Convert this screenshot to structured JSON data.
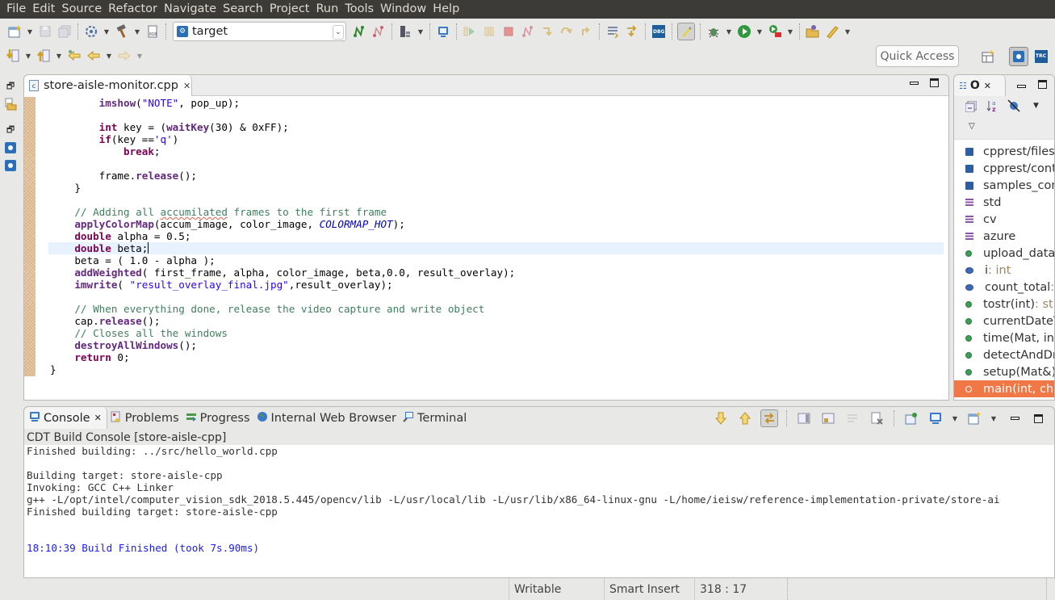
{
  "menubar": {
    "items": [
      "File",
      "Edit",
      "Source",
      "Refactor",
      "Navigate",
      "Search",
      "Project",
      "Run",
      "Tools",
      "Window",
      "Help"
    ]
  },
  "toolbar": {
    "target_combo": {
      "value": "target",
      "icon": "launch-config-icon"
    },
    "quick_access_label": "Quick Access"
  },
  "editor": {
    "tab_label": "store-aisle-monitor.cpp",
    "code_lines": [
      {
        "indent": "        ",
        "tokens": [
          [
            "fn",
            "imshow"
          ],
          [
            "",
            "("
          ],
          [
            "str",
            "\"NOTE\""
          ],
          [
            "",
            ", pop_up);"
          ]
        ]
      },
      {
        "indent": "",
        "tokens": []
      },
      {
        "indent": "        ",
        "tokens": [
          [
            "kw",
            "int"
          ],
          [
            "",
            " key = ("
          ],
          [
            "fn",
            "waitKey"
          ],
          [
            "",
            "(30) & 0xFF);"
          ]
        ]
      },
      {
        "indent": "        ",
        "tokens": [
          [
            "kw",
            "if"
          ],
          [
            "",
            "(key =="
          ],
          [
            "chr",
            "'q'"
          ],
          [
            "",
            ")"
          ]
        ]
      },
      {
        "indent": "            ",
        "tokens": [
          [
            "kw",
            "break"
          ],
          [
            "",
            ";"
          ]
        ]
      },
      {
        "indent": "",
        "tokens": []
      },
      {
        "indent": "        ",
        "tokens": [
          [
            "",
            "frame."
          ],
          [
            "fn",
            "release"
          ],
          [
            "",
            "();"
          ]
        ]
      },
      {
        "indent": "    ",
        "tokens": [
          [
            "",
            "}"
          ]
        ]
      },
      {
        "indent": "",
        "tokens": []
      },
      {
        "indent": "    ",
        "tokens": [
          [
            "cm",
            "// Adding all "
          ],
          [
            "cm squig",
            "accumilated"
          ],
          [
            "cm",
            " frames to the first frame"
          ]
        ]
      },
      {
        "indent": "    ",
        "tokens": [
          [
            "fn",
            "applyColorMap"
          ],
          [
            "",
            "(accum_image, color_image, "
          ],
          [
            "it",
            "COLORMAP_HOT"
          ],
          [
            "",
            ");"
          ]
        ]
      },
      {
        "indent": "    ",
        "tokens": [
          [
            "kw",
            "double"
          ],
          [
            "",
            " alpha = 0.5;"
          ]
        ]
      },
      {
        "indent": "    ",
        "tokens": [
          [
            "kw",
            "double"
          ],
          [
            "",
            " beta;"
          ],
          [
            "caret",
            ""
          ]
        ],
        "current": true
      },
      {
        "indent": "    ",
        "tokens": [
          [
            "",
            "beta = ( 1.0 - alpha );"
          ]
        ]
      },
      {
        "indent": "    ",
        "tokens": [
          [
            "fn",
            "addWeighted"
          ],
          [
            "",
            "( first_frame, alpha, color_image, beta,0.0, result_overlay);"
          ]
        ]
      },
      {
        "indent": "    ",
        "tokens": [
          [
            "fn",
            "imwrite"
          ],
          [
            "",
            "( "
          ],
          [
            "str",
            "\"result_overlay_final.jpg\""
          ],
          [
            "",
            ",result_overlay);"
          ]
        ]
      },
      {
        "indent": "",
        "tokens": []
      },
      {
        "indent": "    ",
        "tokens": [
          [
            "cm",
            "// When everything done, release the video capture and write object"
          ]
        ]
      },
      {
        "indent": "    ",
        "tokens": [
          [
            "",
            "cap."
          ],
          [
            "fn",
            "release"
          ],
          [
            "",
            "();"
          ]
        ]
      },
      {
        "indent": "    ",
        "tokens": [
          [
            "cm",
            "// Closes all the windows"
          ]
        ]
      },
      {
        "indent": "    ",
        "tokens": [
          [
            "fn",
            "destroyAllWindows"
          ],
          [
            "",
            "();"
          ]
        ]
      },
      {
        "indent": "    ",
        "tokens": [
          [
            "kw",
            "return"
          ],
          [
            "",
            " 0;"
          ]
        ]
      },
      {
        "indent": "",
        "tokens": [
          [
            "",
            "}"
          ]
        ]
      }
    ]
  },
  "outline": {
    "tab_label": "O",
    "items": [
      {
        "kind": "include",
        "label": "cpprest/files"
      },
      {
        "kind": "include",
        "label": "cpprest/cont"
      },
      {
        "kind": "include",
        "label": "samples_com"
      },
      {
        "kind": "namespace",
        "label": "std"
      },
      {
        "kind": "namespace",
        "label": "cv"
      },
      {
        "kind": "namespace",
        "label": "azure"
      },
      {
        "kind": "function",
        "label": "upload_data("
      },
      {
        "kind": "field",
        "label": "i",
        "type": " : int"
      },
      {
        "kind": "field",
        "label": "count_total",
        "type": " :"
      },
      {
        "kind": "function",
        "label": "tostr(int)",
        "type": " : str"
      },
      {
        "kind": "function",
        "label": "currentDateT"
      },
      {
        "kind": "function",
        "label": "time(Mat, int"
      },
      {
        "kind": "function",
        "label": "detectAndDr"
      },
      {
        "kind": "function",
        "label": "setup(Mat&)"
      },
      {
        "kind": "function",
        "label": "main(int, cha",
        "selected": true
      }
    ]
  },
  "console": {
    "tabs": [
      {
        "label": "Console",
        "icon": "console-icon",
        "active": true
      },
      {
        "label": "Problems",
        "icon": "problems-icon"
      },
      {
        "label": "Progress",
        "icon": "progress-icon"
      },
      {
        "label": "Internal Web Browser",
        "icon": "globe-icon"
      },
      {
        "label": "Terminal",
        "icon": "terminal-icon"
      }
    ],
    "title": "CDT Build Console [store-aisle-cpp]",
    "lines": [
      {
        "text": "Finished building: ../src/hello_world.cpp"
      },
      {
        "text": ""
      },
      {
        "text": "Building target: store-aisle-cpp"
      },
      {
        "text": "Invoking: GCC C++ Linker"
      },
      {
        "text": "g++ -L/opt/intel/computer_vision_sdk_2018.5.445/opencv/lib -L/usr/local/lib -L/usr/lib/x86_64-linux-gnu -L/home/ieisw/reference-implementation-private/store-ai"
      },
      {
        "text": "Finished building target: store-aisle-cpp"
      },
      {
        "text": ""
      },
      {
        "text": ""
      },
      {
        "text": "18:10:39 Build Finished (took 7s.90ms)",
        "blue": true
      }
    ]
  },
  "statusbar": {
    "writable": "Writable",
    "insert_mode": "Smart Insert",
    "position": "318 : 17"
  },
  "colors": {
    "menubar_bg": "#3c3b37",
    "selection": "#f07746",
    "keyword": "#7f0055",
    "string": "#2a00ff",
    "comment": "#3f7f5f"
  }
}
